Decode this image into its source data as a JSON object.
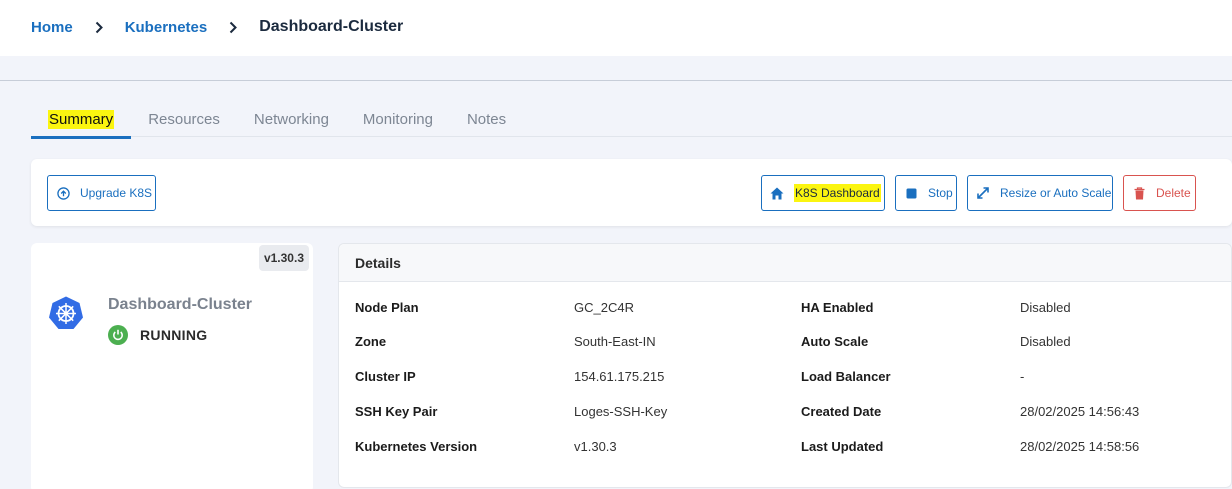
{
  "breadcrumb": {
    "home": "Home",
    "section": "Kubernetes",
    "current": "Dashboard-Cluster"
  },
  "tabs": [
    {
      "label": "Summary",
      "active": true
    },
    {
      "label": "Resources",
      "active": false
    },
    {
      "label": "Networking",
      "active": false
    },
    {
      "label": "Monitoring",
      "active": false
    },
    {
      "label": "Notes",
      "active": false
    }
  ],
  "actions": {
    "upgrade": {
      "label": "Upgrade K8S",
      "icon": "upgrade-circle-icon"
    },
    "k8s_dashboard": {
      "label": "K8S Dashboard",
      "icon": "home-icon"
    },
    "stop": {
      "label": "Stop",
      "icon": "stop-icon"
    },
    "resize": {
      "label": "Resize or Auto Scale",
      "icon": "expand-icon"
    },
    "delete": {
      "label": "Delete",
      "icon": "trash-icon"
    }
  },
  "cluster": {
    "version": "v1.30.3",
    "name": "Dashboard-Cluster",
    "status": "RUNNING",
    "logo_icon": "kubernetes-icon",
    "status_icon": "power-icon"
  },
  "details": {
    "title": "Details",
    "rows": [
      {
        "l1": "Node Plan",
        "v1": "GC_2C4R",
        "l2": "HA Enabled",
        "v2": "Disabled"
      },
      {
        "l1": "Zone",
        "v1": "South-East-IN",
        "l2": "Auto Scale",
        "v2": "Disabled"
      },
      {
        "l1": "Cluster IP",
        "v1": "154.61.175.215",
        "l2": "Load Balancer",
        "v2": "-"
      },
      {
        "l1": "SSH Key Pair",
        "v1": "Loges-SSH-Key",
        "l2": "Created Date",
        "v2": "28/02/2025 14:56:43"
      },
      {
        "l1": "Kubernetes Version",
        "v1": "v1.30.3",
        "l2": "Last Updated",
        "v2": "28/02/2025 14:58:56"
      }
    ]
  },
  "colors": {
    "accent": "#1a6fbf",
    "highlight": "#fbf510",
    "danger": "#d9534f",
    "running": "#4caf50",
    "k8s_logo": "#326ce5"
  }
}
